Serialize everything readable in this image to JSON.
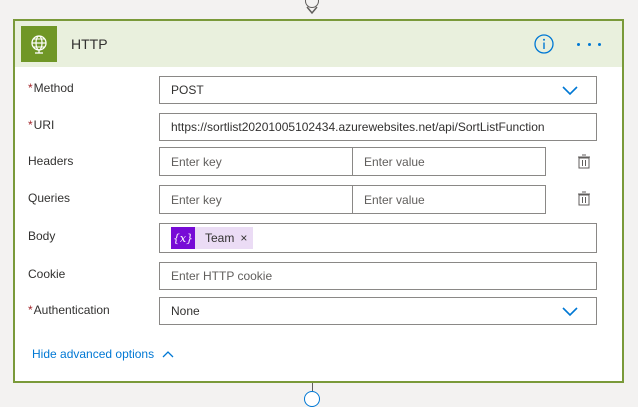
{
  "card": {
    "title": "HTTP",
    "icon": "globe-icon",
    "accent_color": "#709727",
    "header_bg": "#e9f0dd",
    "border_color": "#7a9a3a"
  },
  "header_actions": {
    "info_icon": "info-icon",
    "more_icon": "more-options-icon"
  },
  "fields": {
    "method": {
      "label": "Method",
      "required": "*",
      "value": "POST"
    },
    "uri": {
      "label": "URI",
      "required": "*",
      "value": "https://sortlist20201005102434.azurewebsites.net/api/SortListFunction"
    },
    "headers": {
      "label": "Headers",
      "key_placeholder": "Enter key",
      "value_placeholder": "Enter value"
    },
    "queries": {
      "label": "Queries",
      "key_placeholder": "Enter key",
      "value_placeholder": "Enter value"
    },
    "body": {
      "label": "Body",
      "token_label": "Team",
      "token_icon_text": "{x}",
      "token_remove": "×"
    },
    "cookie": {
      "label": "Cookie",
      "placeholder": "Enter HTTP cookie"
    },
    "authentication": {
      "label": "Authentication",
      "required": "*",
      "value": "None"
    }
  },
  "advanced": {
    "label": "Hide advanced options"
  },
  "colors": {
    "link": "#0078d4",
    "required": "#a4262c",
    "token_bg": "#ebdcf5",
    "token_icon_bg": "#770bd6"
  }
}
